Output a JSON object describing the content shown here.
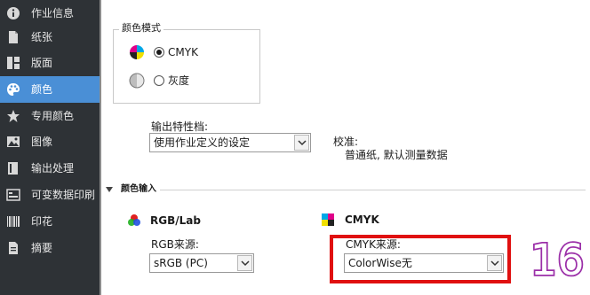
{
  "sidebar": {
    "items": [
      {
        "label": "作业信息",
        "icon": "info-icon"
      },
      {
        "label": "纸张",
        "icon": "document-icon"
      },
      {
        "label": "版面",
        "icon": "layout-icon"
      },
      {
        "label": "颜色",
        "icon": "palette-icon",
        "active": true
      },
      {
        "label": "专用颜色",
        "icon": "star-icon"
      },
      {
        "label": "图像",
        "icon": "image-icon"
      },
      {
        "label": "输出处理",
        "icon": "book-icon"
      },
      {
        "label": "可变数据印刷",
        "icon": "variable-data-icon"
      },
      {
        "label": "印花",
        "icon": "barcode-icon"
      },
      {
        "label": "摘要",
        "icon": "summary-icon"
      }
    ]
  },
  "color_mode": {
    "title": "颜色模式",
    "options": [
      {
        "label": "CMYK",
        "checked": true
      },
      {
        "label": "灰度",
        "checked": false
      }
    ]
  },
  "output_profile": {
    "label": "输出特性档:",
    "value": "使用作业定义的设定"
  },
  "calibration": {
    "label": "校准:",
    "value": "普通纸, 默认测量数据"
  },
  "color_input": {
    "title": "颜色输入",
    "rgb": {
      "heading": "RGB/Lab",
      "source_label": "RGB来源:",
      "source_value": "sRGB (PC)"
    },
    "cmyk": {
      "heading": "CMYK",
      "source_label": "CMYK来源:",
      "source_value": "ColorWise无"
    }
  },
  "annotation": {
    "step_number": "16",
    "highlight_color": "#e01010",
    "number_color": "#9b2fa8"
  },
  "colors": {
    "sidebar_bg": "#2e3236",
    "sidebar_active": "#4a8fd6"
  }
}
